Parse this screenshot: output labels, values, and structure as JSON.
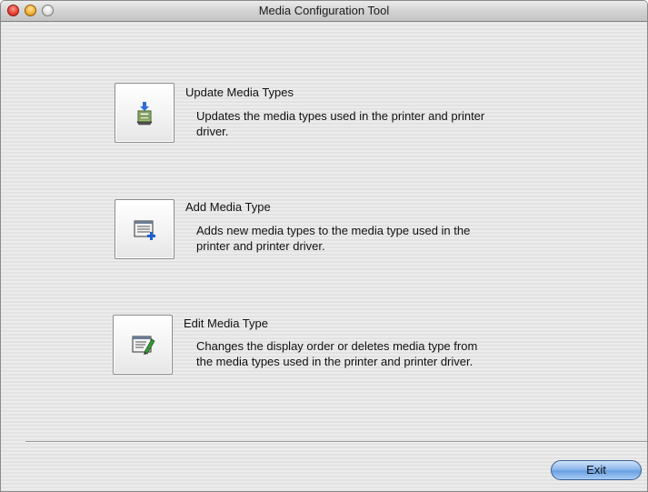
{
  "window": {
    "title": "Media Configuration Tool"
  },
  "options": [
    {
      "heading": "Update Media Types",
      "desc_line1": "Updates the media types used in the printer and printer",
      "desc_line2": "driver.",
      "icon": "update-media-icon"
    },
    {
      "heading": "Add Media Type",
      "desc_line1": "Adds new media types to the media type used in the",
      "desc_line2": "printer and printer driver.",
      "icon": "add-media-icon"
    },
    {
      "heading": "Edit Media Type",
      "desc_line1": "Changes the display order or deletes media type from",
      "desc_line2": "the media types used in the printer and printer driver.",
      "icon": "edit-media-icon"
    }
  ],
  "footer": {
    "exit_label": "Exit"
  },
  "colors": {
    "close": "#e8453a",
    "minimize": "#f4b23a",
    "exit_button": "#8fb8ec"
  }
}
